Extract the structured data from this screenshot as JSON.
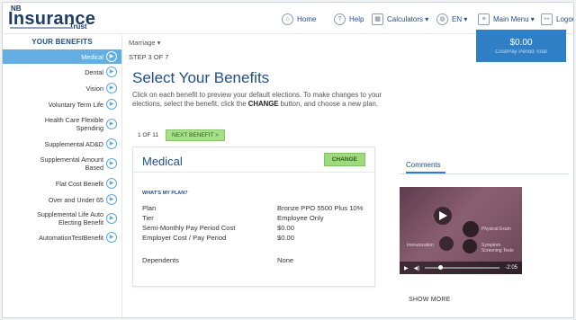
{
  "header": {
    "logo_nb": "NB",
    "logo_name": "Insurance",
    "logo_trust": "Trust",
    "nav": {
      "home": "Home",
      "help": "Help",
      "calculators": "Calculators ▾",
      "language": "EN ▾",
      "main_menu": "Main Menu ▾",
      "logout": "Logout"
    },
    "balance": {
      "amount": "$0.00",
      "sub": "Cost/Pay Period Total"
    }
  },
  "sidebar": {
    "title": "YOUR BENEFITS",
    "items": [
      {
        "label": "Medical",
        "active": true
      },
      {
        "label": "Dental"
      },
      {
        "label": "Vision"
      },
      {
        "label": "Voluntary Term Life"
      },
      {
        "label": "Health Care Flexible Spending"
      },
      {
        "label": "Supplemental AD&D"
      },
      {
        "label": "Supplemental Amount Based"
      },
      {
        "label": "Flat Cost Benefit"
      },
      {
        "label": "Over and Under 65"
      },
      {
        "label": "Supplemental Life Auto Electing Benefit"
      },
      {
        "label": "AutomationTestBenefit"
      }
    ]
  },
  "main": {
    "breadcrumb": "Marriage ▾",
    "step": "STEP 3 OF 7",
    "title": "Select Your Benefits",
    "instructions_a": "Click on each benefit to preview your default elections. To make changes to your elections, select the benefit, click the ",
    "instructions_b": "CHANGE",
    "instructions_c": " button, and choose a new plan.",
    "pager_count": "1 OF 11",
    "next_label": "NEXT BENEFIT >"
  },
  "card": {
    "title": "Medical",
    "change_label": "CHANGE",
    "whats_my_plan": "WHAT'S MY PLAN?",
    "rows": [
      {
        "k": "Plan",
        "v": "Bronze PPO 5500 Plus 10%"
      },
      {
        "k": "Tier",
        "v": "Employee Only"
      },
      {
        "k": "Semi-Monthly Pay Period Cost",
        "v": "$0.00"
      },
      {
        "k": "Employer Cost / Pay Period",
        "v": "$0.00"
      }
    ],
    "dependents_k": "Dependents",
    "dependents_v": "None"
  },
  "comments": {
    "tab": "Comments",
    "video_time": "-2:05",
    "video_labels": [
      "Physical Exam",
      "Immunization",
      "Symptom Screening Tests"
    ],
    "show_more": "SHOW MORE"
  },
  "colors": {
    "brand": "#1f4e8c",
    "accent": "#2f7fc7",
    "active": "#63aee3",
    "go": "#9edb7f"
  }
}
